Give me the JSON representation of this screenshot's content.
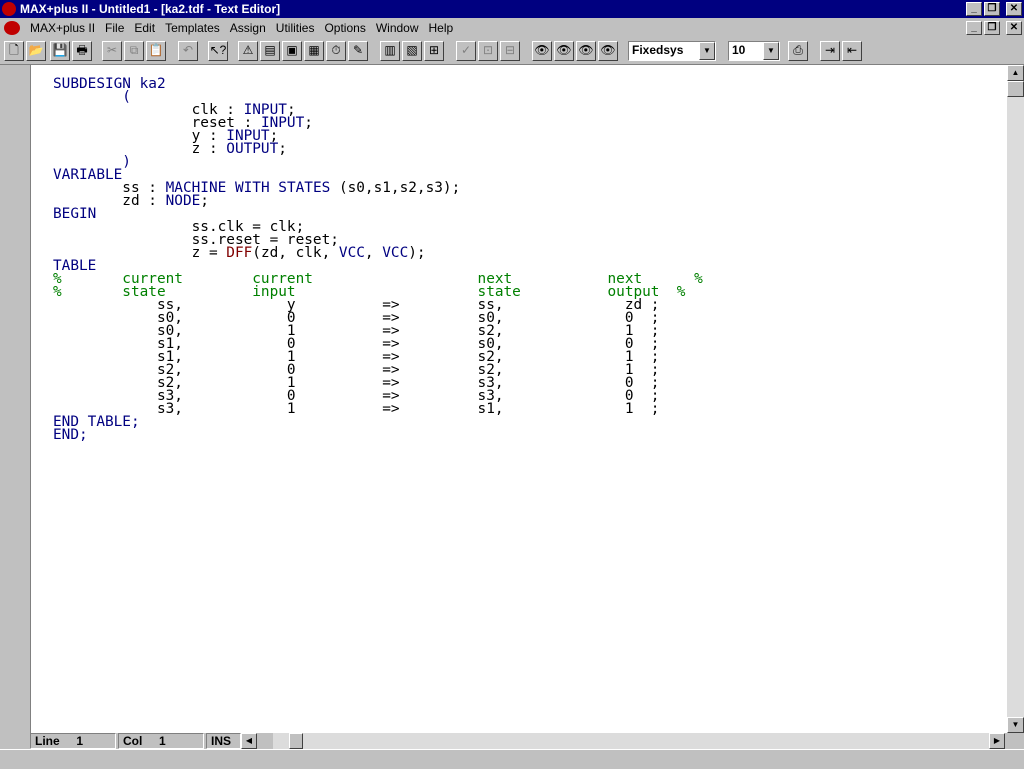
{
  "window": {
    "title": "MAX+plus II - Untitled1 - [ka2.tdf - Text Editor]"
  },
  "menu": {
    "items": [
      {
        "label": "MAX+plus II"
      },
      {
        "label": "File"
      },
      {
        "label": "Edit"
      },
      {
        "label": "Templates"
      },
      {
        "label": "Assign"
      },
      {
        "label": "Utilities"
      },
      {
        "label": "Options"
      },
      {
        "label": "Window"
      },
      {
        "label": "Help"
      }
    ]
  },
  "toolbar": {
    "font_value": "Fixedsys",
    "size_value": "10",
    "icons": [
      "new-file-icon",
      "open-file-icon",
      "save-icon",
      "print-icon",
      "cut-icon",
      "copy-icon",
      "paste-icon",
      "undo-icon",
      "context-help-icon",
      "hierarchy-icon",
      "floorplan-icon",
      "compiler-icon",
      "simulator-icon",
      "timing-analyzer-icon",
      "programmer-icon",
      "project-icon",
      "top-level-icon",
      "hierarchy-display-icon",
      "check-icon",
      "save-check-icon",
      "save-compile-icon",
      "find-icon",
      "replace-icon",
      "find-next-icon",
      "marker-icon",
      "print-selection-icon",
      "indent-icon",
      "outdent-icon"
    ]
  },
  "editor": {
    "lines": [
      [
        "SUBDESIGN ka2",
        "kw"
      ],
      [
        "        (",
        "kw"
      ],
      [
        "                clk : INPUT;",
        "mix1"
      ],
      [
        "                reset : INPUT;",
        "mix2"
      ],
      [
        "                y : INPUT;",
        "mix3"
      ],
      [
        "                z : OUTPUT;",
        "mix4"
      ],
      [
        "        )",
        "kw"
      ],
      [
        "VARIABLE",
        "kw"
      ],
      [
        "        ss : MACHINE WITH STATES (s0,s1,s2,s3);",
        "mix5"
      ],
      [
        "        zd : NODE;",
        "mix6"
      ],
      [
        "BEGIN",
        "kw"
      ],
      [
        "                ss.clk = clk;",
        "plain"
      ],
      [
        "                ss.reset = reset;",
        "plain"
      ],
      [
        "                z = DFF(zd, clk, VCC, VCC);",
        "mix7"
      ],
      [
        "TABLE",
        "kw"
      ],
      [
        "%       current        current                   next           next      %",
        "cm"
      ],
      [
        "%       state          input                     state          output  %",
        "cm"
      ],
      [
        "            ss,            y          =>         ss,              zd ;",
        "plain"
      ],
      [
        "            s0,            0          =>         s0,              0  ;",
        "plain"
      ],
      [
        "            s0,            1          =>         s2,              1  ;",
        "plain"
      ],
      [
        "            s1,            0          =>         s0,              0  ;",
        "plain"
      ],
      [
        "            s1,            1          =>         s2,              1  ;",
        "plain"
      ],
      [
        "            s2,            0          =>         s2,              1  ;",
        "plain"
      ],
      [
        "            s2,            1          =>         s3,              0  ;",
        "plain"
      ],
      [
        "            s3,            0          =>         s3,              0  ;",
        "plain"
      ],
      [
        "            s3,            1          =>         s1,              1  ;",
        "plain"
      ],
      [
        "END TABLE;",
        "kw"
      ],
      [
        "END;",
        "kw"
      ]
    ]
  },
  "status": {
    "line_label": "Line",
    "line_value": "1",
    "col_label": "Col",
    "col_value": "1",
    "mode": "INS"
  }
}
